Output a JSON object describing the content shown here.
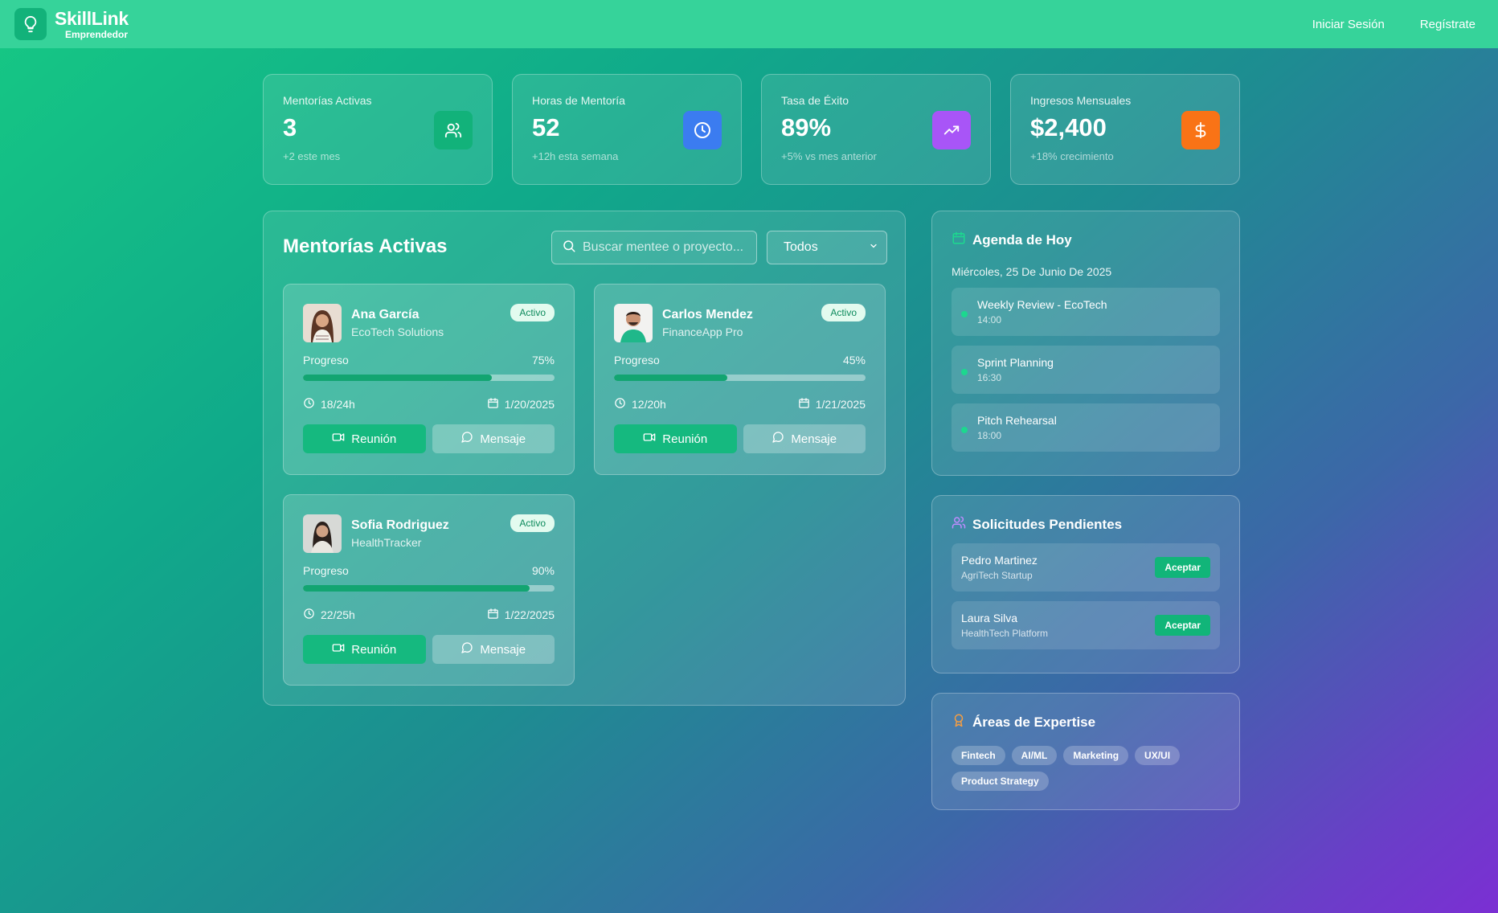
{
  "header": {
    "brand_name": "SkillLink",
    "brand_sub": "Emprendedor",
    "nav": [
      "Iniciar Sesión",
      "Regístrate"
    ]
  },
  "stats": [
    {
      "label": "Mentorías Activas",
      "value": "3",
      "sub": "+2 este mes",
      "icon": "users-icon",
      "color": "#12b27a"
    },
    {
      "label": "Horas de Mentoría",
      "value": "52",
      "sub": "+12h esta semana",
      "icon": "clock-icon",
      "color": "#3b7cf0"
    },
    {
      "label": "Tasa de Éxito",
      "value": "89%",
      "sub": "+5% vs mes anterior",
      "icon": "trending-up-icon",
      "color": "#a855f7"
    },
    {
      "label": "Ingresos Mensuales",
      "value": "$2,400",
      "sub": "+18% crecimiento",
      "icon": "dollar-icon",
      "color": "#f97316"
    }
  ],
  "mentorias": {
    "title": "Mentorías Activas",
    "search_placeholder": "Buscar mentee o proyecto...",
    "filter_value": "Todos",
    "progress_label": "Progreso",
    "meeting_label": "Reunión",
    "message_label": "Mensaje",
    "cards": [
      {
        "name": "Ana García",
        "company": "EcoTech Solutions",
        "status": "Activo",
        "progress": 75,
        "progress_text": "75%",
        "hours": "18/24h",
        "date": "1/20/2025"
      },
      {
        "name": "Carlos Mendez",
        "company": "FinanceApp Pro",
        "status": "Activo",
        "progress": 45,
        "progress_text": "45%",
        "hours": "12/20h",
        "date": "1/21/2025"
      },
      {
        "name": "Sofia Rodriguez",
        "company": "HealthTracker",
        "status": "Activo",
        "progress": 90,
        "progress_text": "90%",
        "hours": "22/25h",
        "date": "1/22/2025"
      }
    ]
  },
  "agenda": {
    "title": "Agenda de Hoy",
    "date": "Miércoles, 25 De Junio De 2025",
    "items": [
      {
        "title": "Weekly Review - EcoTech",
        "time": "14:00"
      },
      {
        "title": "Sprint Planning",
        "time": "16:30"
      },
      {
        "title": "Pitch Rehearsal",
        "time": "18:00"
      }
    ]
  },
  "solicitudes": {
    "title": "Solicitudes Pendientes",
    "accept_label": "Aceptar",
    "items": [
      {
        "name": "Pedro Martinez",
        "company": "AgriTech Startup"
      },
      {
        "name": "Laura Silva",
        "company": "HealthTech Platform"
      }
    ]
  },
  "expertise": {
    "title": "Áreas de Expertise",
    "tags": [
      "Fintech",
      "AI/ML",
      "Marketing",
      "UX/UI",
      "Product Strategy"
    ]
  }
}
